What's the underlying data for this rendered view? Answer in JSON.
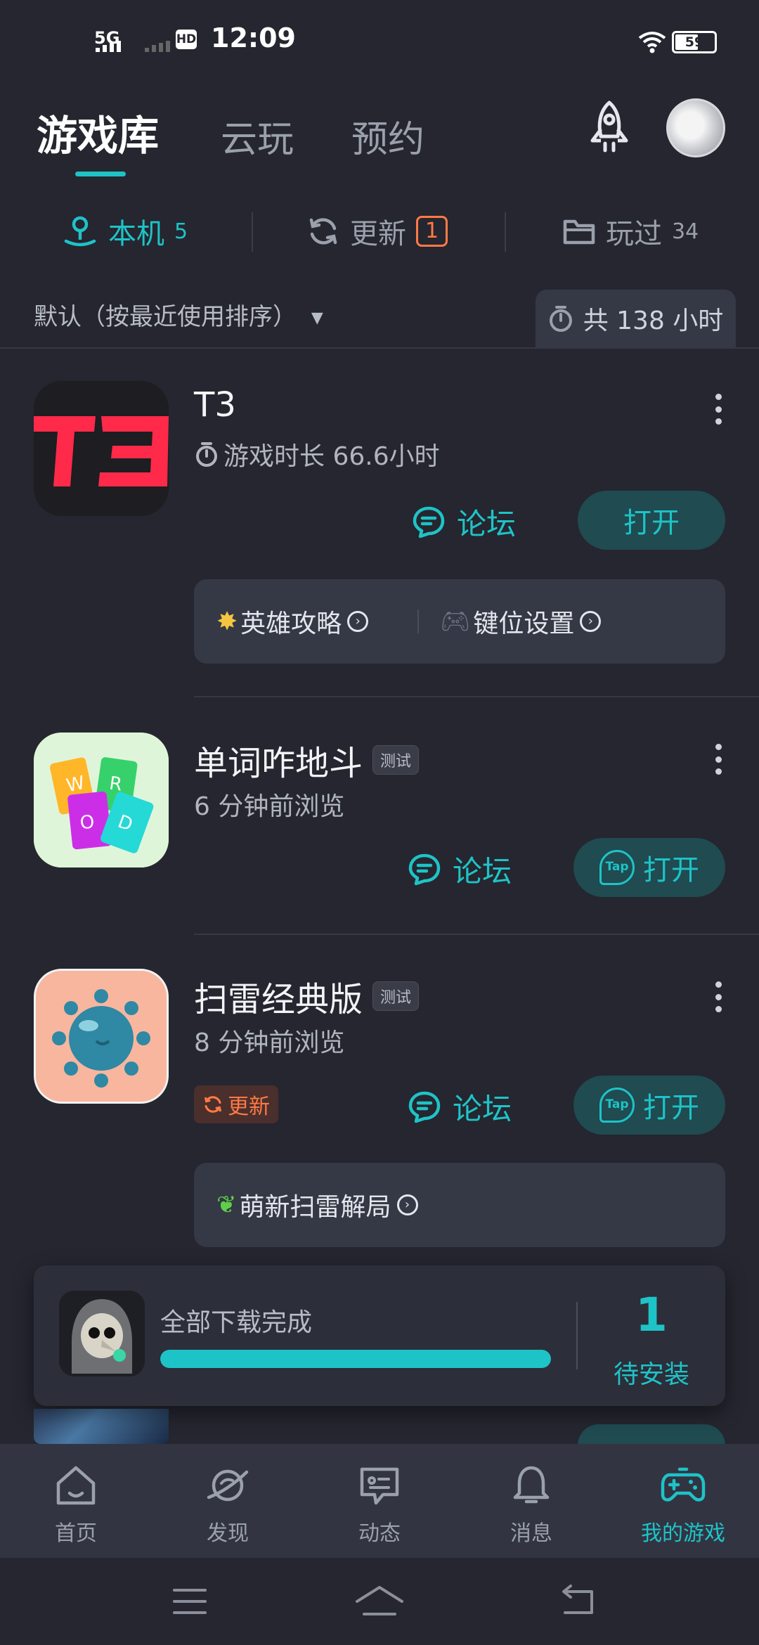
{
  "status_bar": {
    "time": "12:09",
    "signal": "5G",
    "hd": "HD",
    "battery": "59"
  },
  "header": {
    "tabs": [
      {
        "label": "游戏库",
        "active": true
      },
      {
        "label": "云玩",
        "active": false
      },
      {
        "label": "预约",
        "active": false
      }
    ]
  },
  "filters": [
    {
      "label": "本机",
      "count": "5",
      "active": true
    },
    {
      "label": "更新",
      "count": "1",
      "active": false
    },
    {
      "label": "玩过",
      "count": "34",
      "active": false
    }
  ],
  "sort": {
    "label": "默认（按最近使用排序）"
  },
  "total_hours": "共 138 小时",
  "games": [
    {
      "title": "T3",
      "subtitle": "游戏时长 66.6小时",
      "forum_label": "论坛",
      "open_label": "打开",
      "links": [
        "英雄攻略",
        "键位设置"
      ]
    },
    {
      "title": "单词咋地斗",
      "tag": "测试",
      "subtitle": "6 分钟前浏览",
      "forum_label": "论坛",
      "open_label": "打开"
    },
    {
      "title": "扫雷经典版",
      "tag": "测试",
      "subtitle": "8 分钟前浏览",
      "update_label": "更新",
      "forum_label": "论坛",
      "open_label": "打开",
      "links": [
        "萌新扫雷解局"
      ]
    }
  ],
  "download": {
    "status": "全部下载完成",
    "progress": 1.0,
    "pending_count": "1",
    "pending_label": "待安装"
  },
  "bottom_nav": [
    {
      "label": "首页",
      "icon": "home-icon",
      "active": false
    },
    {
      "label": "发现",
      "icon": "planet-icon",
      "active": false
    },
    {
      "label": "动态",
      "icon": "message-icon",
      "active": false
    },
    {
      "label": "消息",
      "icon": "bell-icon",
      "active": false
    },
    {
      "label": "我的游戏",
      "icon": "gamepad-icon",
      "active": true
    }
  ],
  "colors": {
    "accent": "#1ec3c7",
    "update": "#ff7a45",
    "background": "#25262f"
  }
}
